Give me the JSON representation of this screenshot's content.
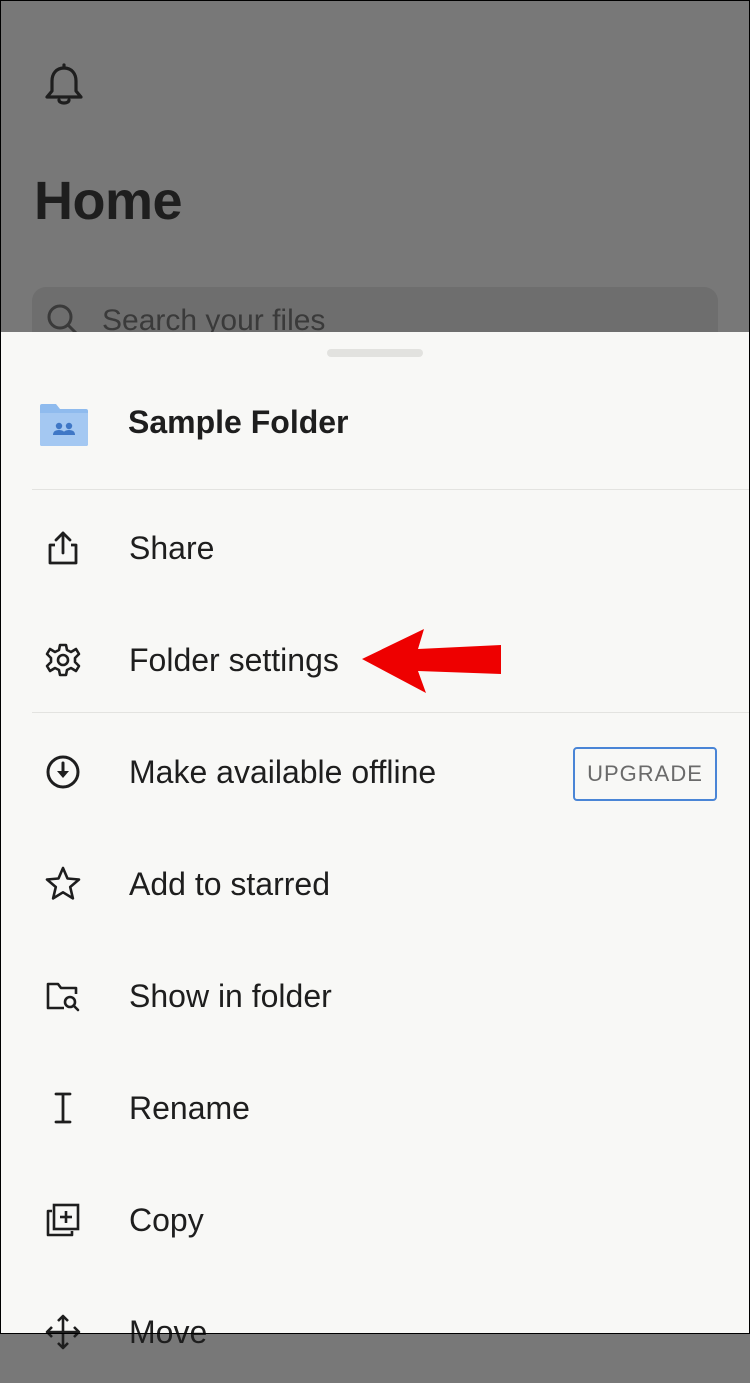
{
  "home": {
    "title": "Home",
    "search_placeholder": "Search your files"
  },
  "sheet": {
    "folder_name": "Sample Folder",
    "menu": [
      {
        "label": "Share",
        "icon": "share-icon"
      },
      {
        "label": "Folder settings",
        "icon": "gear-icon"
      },
      {
        "label": "Make available offline",
        "icon": "download-circle-icon",
        "badge": "UPGRADE"
      },
      {
        "label": "Add to starred",
        "icon": "star-icon"
      },
      {
        "label": "Show in folder",
        "icon": "folder-search-icon"
      },
      {
        "label": "Rename",
        "icon": "text-cursor-icon"
      },
      {
        "label": "Copy",
        "icon": "copy-icon"
      },
      {
        "label": "Move",
        "icon": "move-icon"
      }
    ]
  },
  "colors": {
    "backdrop": "#787878",
    "sheet": "#f8f8f6",
    "folder_accent": "#8fbbee",
    "upgrade_border": "#4a85d6",
    "annotation_arrow": "#ee0000"
  }
}
